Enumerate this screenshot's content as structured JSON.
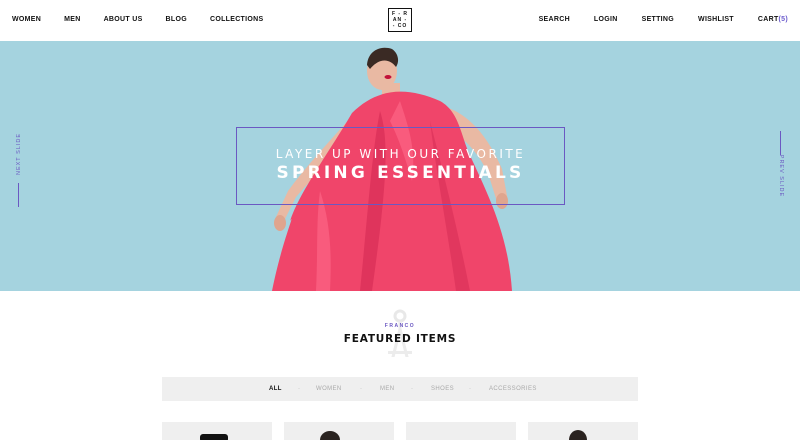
{
  "header": {
    "nav_left": [
      "WOMEN",
      "MEN",
      "ABOUT US",
      "BLOG",
      "COLLECTIONS"
    ],
    "nav_right": {
      "search": "SEARCH",
      "login": "LOGIN",
      "setting": "SETTING",
      "wishlist": "WISHLIST",
      "cart_label": "CART",
      "cart_count": "(5)"
    },
    "logo_lines": [
      "F - R",
      "AN -",
      "- CO"
    ]
  },
  "hero": {
    "subtitle": "LAYER UP WITH OUR FAVORITE",
    "title": "SPRING ESSENTIALS",
    "next_slide": "NEXT SLIDE",
    "prev_slide": "PREV SLIDE"
  },
  "featured": {
    "kicker": "FRANCO",
    "title": "FEATURED ITEMS",
    "filters": [
      "ALL",
      "WOMEN",
      "MEN",
      "SHOES",
      "ACCESSORIES"
    ],
    "active_filter": "ALL"
  },
  "colors": {
    "accent": "#6b58c2",
    "hero_bg": "#a5d3df",
    "dress": "#f0456a"
  }
}
